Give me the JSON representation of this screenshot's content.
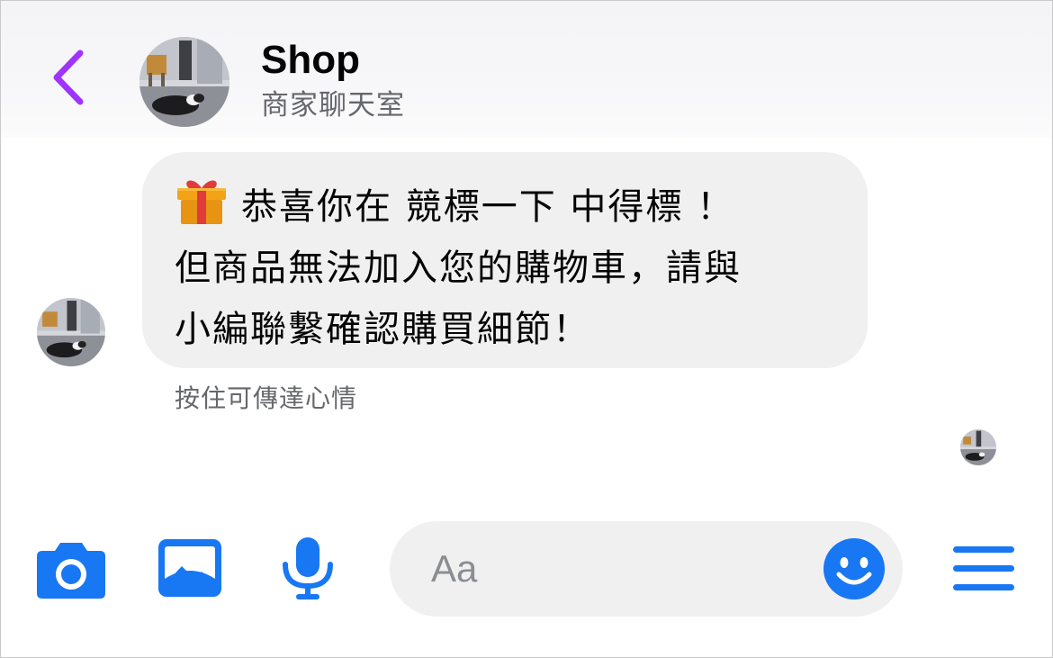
{
  "header": {
    "title": "Shop",
    "subtitle": "商家聊天室"
  },
  "message": {
    "lines": [
      "恭喜你在 競標一下 中得標 ！",
      "但商品無法加入您的購物車，請與",
      "小編聯繫確認購買細節！"
    ],
    "icon": "gift-icon",
    "hint": "按住可傳達心情"
  },
  "composer": {
    "placeholder": "Aa"
  },
  "toolbar": {
    "icons": [
      "camera-icon",
      "image-icon",
      "microphone-icon",
      "smiley-icon",
      "menu-icon"
    ]
  },
  "colors": {
    "accent": "#1877F2",
    "back": "#A033FF",
    "bubble": "#F0F0F0",
    "secondary_text": "#65676B"
  }
}
